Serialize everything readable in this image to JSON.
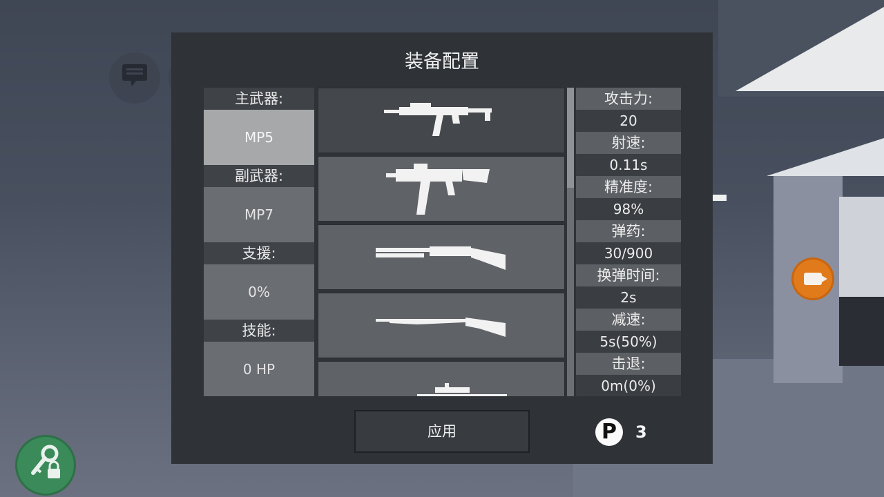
{
  "dialog": {
    "title": "装备配置",
    "apply_label": "应用"
  },
  "loadout": [
    {
      "label": "主武器:",
      "value": "MP5",
      "selected": true
    },
    {
      "label": "副武器:",
      "value": "MP7"
    },
    {
      "label": "支援:",
      "value": "0%"
    },
    {
      "label": "技能:",
      "value": "0 HP"
    }
  ],
  "weapons": [
    {
      "icon": "submachine-gun-mp5-icon"
    },
    {
      "icon": "submachine-gun-ump-icon"
    },
    {
      "icon": "shotgun-icon"
    },
    {
      "icon": "bolt-action-rifle-icon"
    },
    {
      "icon": "sniper-rifle-icon"
    }
  ],
  "stats": [
    {
      "label": "攻击力:",
      "value": "20"
    },
    {
      "label": "射速:",
      "value": "0.11s"
    },
    {
      "label": "精准度:",
      "value": "98%"
    },
    {
      "label": "弹药:",
      "value": "30/900"
    },
    {
      "label": "换弹时间:",
      "value": "2s"
    },
    {
      "label": "减速:",
      "value": "5s(50%)"
    },
    {
      "label": "击退:",
      "value": "0m(0%)"
    }
  ],
  "points": {
    "symbol": "P",
    "value": "3"
  },
  "hud": {
    "chat_icon": "chat-icon",
    "emote_icon": "emote-icon",
    "map_icon": "map-icon",
    "record_icon": "video-camera-icon",
    "unlock_icon": "key-lock-icon"
  }
}
